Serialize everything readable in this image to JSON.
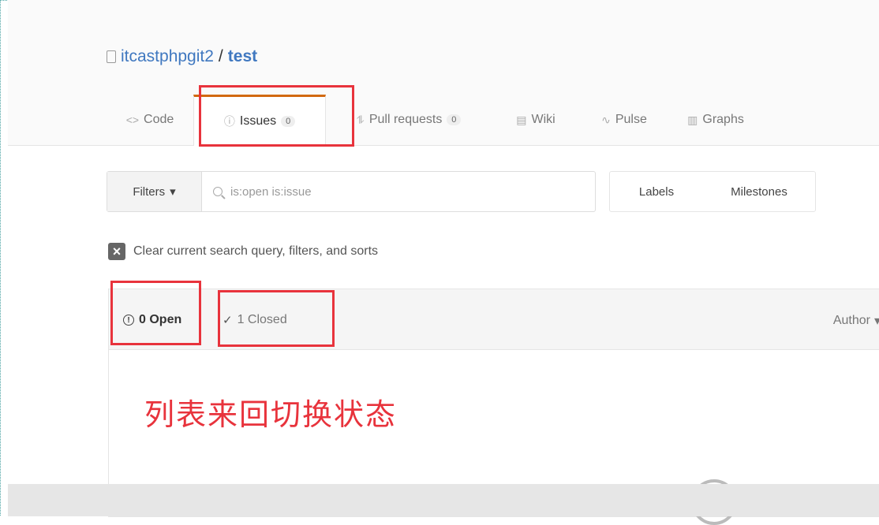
{
  "repo": {
    "owner": "itcastphpgit2",
    "separator": "/",
    "name": "test"
  },
  "tabs": [
    {
      "label": "Code",
      "icon": "<>"
    },
    {
      "label": "Issues",
      "icon": "ⓘ",
      "count": "0"
    },
    {
      "label": "Pull requests",
      "icon": "⥮",
      "count": "0"
    },
    {
      "label": "Wiki",
      "icon": "▤"
    },
    {
      "label": "Pulse",
      "icon": "∿"
    },
    {
      "label": "Graphs",
      "icon": "▥"
    }
  ],
  "filters": {
    "label": "Filters",
    "search_value": "is:open is:issue"
  },
  "labels_label": "Labels",
  "milestones_label": "Milestones",
  "clear_text": "Clear current search query, filters, and sorts",
  "list": {
    "open_label": "0 Open",
    "closed_label": "1 Closed",
    "author_label": "Author"
  },
  "annotation": "列表来回切换状态",
  "colors": {
    "accent": "#e8333c",
    "link": "#4078c0",
    "tab_top": "#d26911"
  }
}
